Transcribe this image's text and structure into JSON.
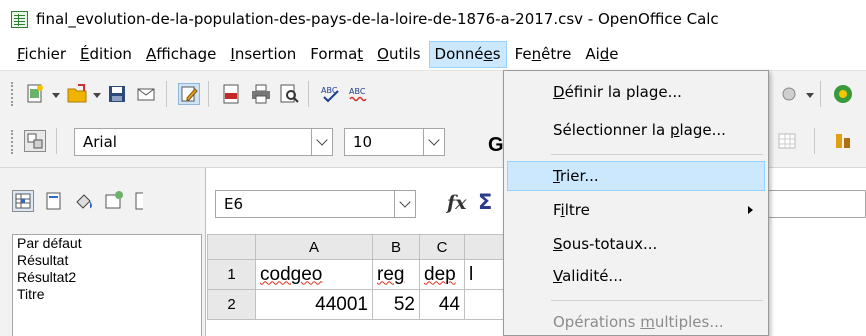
{
  "window": {
    "title": "final_evolution-de-la-population-des-pays-de-la-loire-de-1876-a-2017.csv - OpenOffice Calc"
  },
  "menubar": {
    "items": [
      {
        "pre": "",
        "acc": "F",
        "post": "ichier"
      },
      {
        "pre": "",
        "acc": "É",
        "post": "dition"
      },
      {
        "pre": "",
        "acc": "A",
        "post": "ffichage"
      },
      {
        "pre": "",
        "acc": "I",
        "post": "nsertion"
      },
      {
        "pre": "Forma",
        "acc": "t",
        "post": ""
      },
      {
        "pre": "",
        "acc": "O",
        "post": "utils"
      },
      {
        "pre": "Donné",
        "acc": "e",
        "post": "s"
      },
      {
        "pre": "Fe",
        "acc": "n",
        "post": "être"
      },
      {
        "pre": "Ai",
        "acc": "d",
        "post": "e"
      }
    ],
    "active_index": 6
  },
  "toolbar": {
    "font_name": "Arial",
    "font_size": "10",
    "bold_label": "G",
    "icons": [
      "new-document-icon",
      "open-folder-icon",
      "save-icon",
      "email-icon",
      "edit-file-icon",
      "export-pdf-icon",
      "print-icon",
      "page-preview-icon",
      "spellcheck-icon",
      "autospellcheck-icon"
    ]
  },
  "styles_panel": {
    "items": [
      "Par défaut",
      "Résultat",
      "Résultat2",
      "Titre"
    ],
    "selected_index": 0
  },
  "formula_bar": {
    "cell_ref": "E6",
    "fx_label": "fx",
    "sigma_label": "Σ"
  },
  "sheet": {
    "columns": [
      "A",
      "B",
      "C",
      ""
    ],
    "rows": [
      {
        "num": "1",
        "cells": [
          "codgeo",
          "reg",
          "dep",
          "l"
        ]
      },
      {
        "num": "2",
        "cells": [
          "44001",
          "52",
          "44",
          ""
        ]
      }
    ]
  },
  "dropdown": {
    "items": [
      {
        "pre": "",
        "acc": "D",
        "post": "éfinir la plage...",
        "state": "normal"
      },
      {
        "pre": "Sélectionner la ",
        "acc": "p",
        "post": "lage...",
        "state": "normal"
      },
      {
        "pre": "",
        "acc": "T",
        "post": "rier...",
        "state": "hover"
      },
      {
        "pre": "F",
        "acc": "i",
        "post": "ltre",
        "state": "normal",
        "submenu": true
      },
      {
        "pre": "",
        "acc": "S",
        "post": "ous-totaux...",
        "state": "normal"
      },
      {
        "pre": "",
        "acc": "V",
        "post": "alidité...",
        "state": "normal"
      },
      {
        "pre": "Opérations ",
        "acc": "m",
        "post": "ultiples...",
        "state": "disabled"
      }
    ]
  },
  "colors": {
    "menu_highlight": "#cce8ff",
    "menu_highlight_border": "#99d1ff",
    "selection_blue": "#3399ff",
    "toolbar_bg": "#f2f2f2",
    "disabled_text": "#8c8c8c"
  }
}
